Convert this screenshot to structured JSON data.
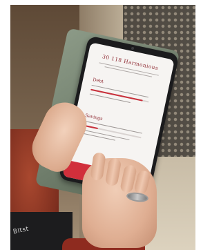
{
  "photo": {
    "description_label": "Photo of a hand holding a smartphone in a green wallet case",
    "accent_color": "#c9313c"
  },
  "phone_screen": {
    "app_title": "30 118 Harmonious",
    "sections": [
      {
        "label": "Debt",
        "progress": 0.9
      },
      {
        "label": "Savings",
        "progress": 0.25
      }
    ],
    "bottom_button_icon": "check-circle-icon"
  },
  "sleeve": {
    "text": "Bitst"
  }
}
